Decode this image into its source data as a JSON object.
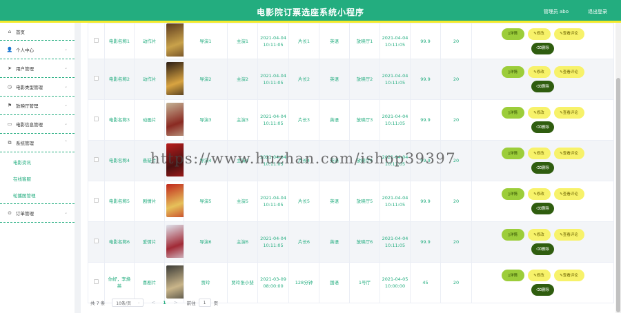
{
  "header": {
    "title": "电影院订票选座系统小程序",
    "user_label": "管理员 abo",
    "logout_label": "退出登录"
  },
  "sidebar": {
    "items": [
      {
        "label": "首页",
        "icon": "home-icon",
        "glyph": "⌂",
        "has_arrow": false
      },
      {
        "label": "个人中心",
        "icon": "user-icon",
        "glyph": "👤",
        "has_arrow": true
      },
      {
        "label": "用户管理",
        "icon": "send-icon",
        "glyph": "➤",
        "has_arrow": true
      },
      {
        "label": "电影类型管理",
        "icon": "clock-icon",
        "glyph": "◷",
        "has_arrow": true
      },
      {
        "label": "放映厅管理",
        "icon": "flag-icon",
        "glyph": "⚑",
        "has_arrow": true
      },
      {
        "label": "电影信息管理",
        "icon": "drive-icon",
        "glyph": "▭",
        "has_arrow": true
      },
      {
        "label": "系统管理",
        "icon": "copy-icon",
        "glyph": "⧉",
        "has_arrow": true,
        "expanded": true
      },
      {
        "label": "订单管理",
        "icon": "settings-icon",
        "glyph": "⊙",
        "has_arrow": true
      }
    ],
    "subitems": [
      "电影资讯",
      "在线客服",
      "轮播图管理"
    ]
  },
  "table": {
    "buttons": {
      "detail": "详情",
      "edit": "修改",
      "review": "查看评论",
      "delete": "删除"
    },
    "rows": [
      {
        "name": "电影名称1",
        "type": "动作片",
        "director": "导演1",
        "actor": "主演1",
        "date": "2021-04-04 10:11:05",
        "length": "片长1",
        "region": "英语",
        "hall": "放映厅1",
        "date2": "2021-04-04 10:11:05",
        "price": "99.9",
        "seats": "20",
        "colors": [
          "#5c3a1e",
          "#c9a24a"
        ]
      },
      {
        "name": "电影名称2",
        "type": "动作片",
        "director": "导演2",
        "actor": "主演2",
        "date": "2021-04-04 10:11:05",
        "length": "片长2",
        "region": "英语",
        "hall": "放映厅2",
        "date2": "2021-04-04 10:11:05",
        "price": "99.9",
        "seats": "20",
        "colors": [
          "#2b1d14",
          "#d9a441"
        ]
      },
      {
        "name": "电影名称3",
        "type": "动画片",
        "director": "导演3",
        "actor": "主演3",
        "date": "2021-04-04 10:11:05",
        "length": "片长3",
        "region": "英语",
        "hall": "放映厅3",
        "date2": "2021-04-04 10:11:05",
        "price": "99.9",
        "seats": "20",
        "colors": [
          "#c5b396",
          "#8a2a22"
        ]
      },
      {
        "name": "电影名称4",
        "type": "悬疑片",
        "director": "导演4",
        "actor": "主演4",
        "date": "2021-04-04 10:11:05",
        "length": "片长4",
        "region": "英语",
        "hall": "放映厅4",
        "date2": "2021-04-04 10:11:05",
        "price": "99.9",
        "seats": "20",
        "colors": [
          "#b81d1d",
          "#4a1010"
        ]
      },
      {
        "name": "电影名称5",
        "type": "剧情片",
        "director": "导演5",
        "actor": "主演5",
        "date": "2021-04-04 10:11:05",
        "length": "片长5",
        "region": "英语",
        "hall": "放映厅5",
        "date2": "2021-04-04 10:11:05",
        "price": "99.9",
        "seats": "20",
        "colors": [
          "#c0281c",
          "#e6c15a"
        ]
      },
      {
        "name": "电影名称6",
        "type": "爱情片",
        "director": "导演6",
        "actor": "主演6",
        "date": "2021-04-04 10:11:05",
        "length": "片长6",
        "region": "英语",
        "hall": "放映厅6",
        "date2": "2021-04-04 10:11:05",
        "price": "99.9",
        "seats": "20",
        "colors": [
          "#dfe3ec",
          "#a12a36"
        ]
      },
      {
        "name": "你好，李焕英",
        "type": "喜剧片",
        "director": "贾玲",
        "actor": "贾玲张小斐",
        "date": "2021-03-09 08:00:00",
        "length": "128分钟",
        "region": "国语",
        "hall": "1号厅",
        "date2": "2021-04-05 10:00:00",
        "price": "45",
        "seats": "20",
        "colors": [
          "#3b3b36",
          "#c9b58a"
        ]
      }
    ]
  },
  "pagination": {
    "total": "共 7 条",
    "page_size": "10条/页",
    "prev": "<",
    "current": "1",
    "next": ">",
    "goto_label": "前往",
    "goto_value": "1",
    "page_suffix": "页"
  },
  "watermark": "https://www.huzhan.com/ishop39397"
}
